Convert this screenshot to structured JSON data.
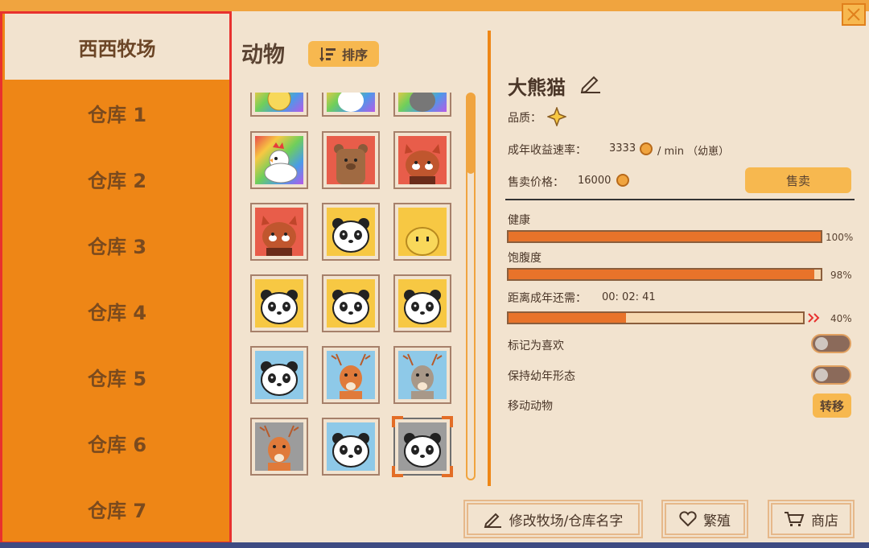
{
  "sidebar": {
    "items": [
      {
        "label": "西西牧场",
        "active": true
      },
      {
        "label": "仓库 1"
      },
      {
        "label": "仓库 2"
      },
      {
        "label": "仓库 3"
      },
      {
        "label": "仓库 4"
      },
      {
        "label": "仓库 5"
      },
      {
        "label": "仓库 6"
      },
      {
        "label": "仓库 7"
      }
    ]
  },
  "animals": {
    "title": "动物",
    "sort_label": "排序",
    "tiles": [
      {
        "name": "rainbow-chick",
        "bg": "rainbow"
      },
      {
        "name": "white-cat",
        "bg": "rainbow"
      },
      {
        "name": "gray-cat",
        "bg": "rainbow"
      },
      {
        "name": "chicken",
        "bg": "rainbow"
      },
      {
        "name": "brown-bear",
        "bg": "#e85d4a"
      },
      {
        "name": "red-panda",
        "bg": "#e85d4a"
      },
      {
        "name": "red-panda",
        "bg": "#e85d4a"
      },
      {
        "name": "panda",
        "bg": "#f7c843"
      },
      {
        "name": "yellow-blob",
        "bg": "#f7c843"
      },
      {
        "name": "panda",
        "bg": "#f7c843"
      },
      {
        "name": "panda",
        "bg": "#f7c843"
      },
      {
        "name": "panda",
        "bg": "#f7c843"
      },
      {
        "name": "panda",
        "bg": "#8ec9e8"
      },
      {
        "name": "deer",
        "bg": "#8ec9e8"
      },
      {
        "name": "gray-deer",
        "bg": "#8ec9e8"
      },
      {
        "name": "deer",
        "bg": "#9c9c9c"
      },
      {
        "name": "panda",
        "bg": "#8ec9e8"
      },
      {
        "name": "panda",
        "bg": "#9c9c9c",
        "selected": true
      }
    ]
  },
  "detail": {
    "name": "大熊猫",
    "quality_label": "品质：",
    "rate_label": "成年收益速率：",
    "rate_value": "3333",
    "rate_unit": "/ min （幼崽）",
    "price_label": "售卖价格：",
    "price_value": "16000",
    "sell_label": "售卖",
    "health_label": "健康",
    "health_pct": "100%",
    "health_value": 100,
    "satiety_label": "饱腹度",
    "satiety_pct": "98%",
    "satiety_value": 98,
    "adult_label": "距离成年还需：",
    "adult_time": "00: 02: 41",
    "adult_pct": "40%",
    "adult_value": 40,
    "favorite_label": "标记为喜欢",
    "keep_young_label": "保持幼年形态",
    "move_label": "移动动物",
    "move_button": "转移"
  },
  "footer": {
    "rename_label": "修改牧场/仓库名字",
    "breed_label": "繁殖",
    "shop_label": "商店"
  },
  "colors": {
    "sidebar": "#ee8616",
    "accent": "#f7b84f",
    "background": "#f2e3cf",
    "bar_fill": "#e8732a",
    "selection_border": "#e8312e"
  }
}
